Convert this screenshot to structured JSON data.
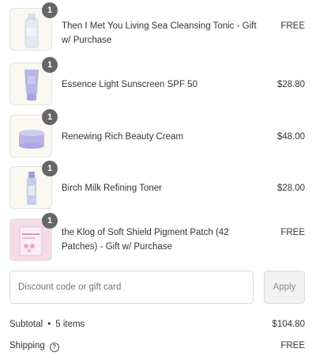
{
  "items": [
    {
      "name": "Then I Met You Living Sea Cleansing Tonic - Gift w/ Purchase",
      "quantity": "1",
      "price": "FREE",
      "thumb": "tonic-bottle-image"
    },
    {
      "name": "Essence Light Sunscreen SPF 50",
      "quantity": "1",
      "price": "$28.80",
      "thumb": "sunscreen-tube-image"
    },
    {
      "name": "Renewing Rich Beauty Cream",
      "quantity": "1",
      "price": "$48.00",
      "thumb": "cream-jar-image"
    },
    {
      "name": "Birch Milk Refining Toner",
      "quantity": "1",
      "price": "$28.00",
      "thumb": "toner-bottle-image"
    },
    {
      "name": "the Klog of Soft Shield Pigment Patch (42 Patches) - Gift w/ Purchase",
      "quantity": "1",
      "price": "FREE",
      "thumb": "patch-box-image"
    }
  ],
  "discount": {
    "placeholder": "Discount code or gift card",
    "apply_label": "Apply"
  },
  "subtotal": {
    "label": "Subtotal",
    "separator": "•",
    "items_count": "5 items",
    "value": "$104.80"
  },
  "shipping": {
    "label": "Shipping",
    "help_icon": "?",
    "value": "FREE"
  },
  "colors": {
    "badge": "#666666",
    "thumb_bg": "#fbf8f1",
    "product_lavender": "#b9b6e6",
    "apply_bg": "#f2f2f2"
  }
}
